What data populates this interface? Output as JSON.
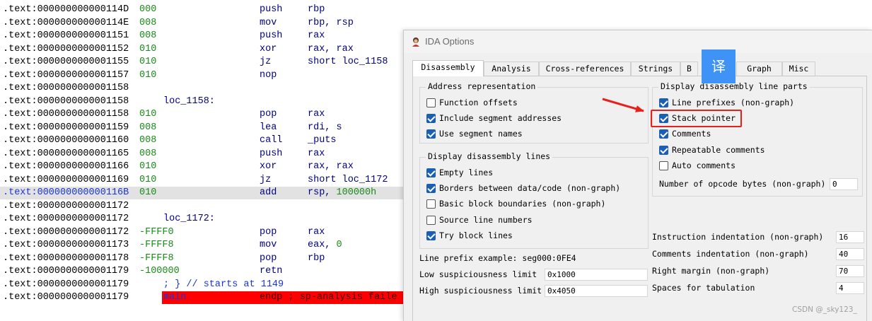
{
  "listing": {
    "lines": [
      {
        "addr": ".text:000000000000114D",
        "sp": "000",
        "mnem": "push",
        "ops": "rbp"
      },
      {
        "addr": ".text:000000000000114E",
        "sp": "008",
        "mnem": "mov",
        "ops": "rbp, rsp"
      },
      {
        "addr": ".text:0000000000001151",
        "sp": "008",
        "mnem": "push",
        "ops": "rax"
      },
      {
        "addr": ".text:0000000000001152",
        "sp": "010",
        "mnem": "xor",
        "ops": "rax, rax"
      },
      {
        "addr": ".text:0000000000001155",
        "sp": "010",
        "mnem": "jz",
        "ops": "short loc_1158"
      },
      {
        "addr": ".text:0000000000001157",
        "sp": "010",
        "mnem": "nop",
        "ops": ""
      },
      {
        "addr": ".text:0000000000001158",
        "sp": "",
        "mnem": "",
        "ops": ""
      },
      {
        "addr": ".text:0000000000001158",
        "sp": "",
        "mnem": "",
        "ops": "",
        "label": "loc_1158:"
      },
      {
        "addr": ".text:0000000000001158",
        "sp": "010",
        "mnem": "pop",
        "ops": "rax"
      },
      {
        "addr": ".text:0000000000001159",
        "sp": "008",
        "mnem": "lea",
        "ops": "rdi, s"
      },
      {
        "addr": ".text:0000000000001160",
        "sp": "008",
        "mnem": "call",
        "ops": "_puts"
      },
      {
        "addr": ".text:0000000000001165",
        "sp": "008",
        "mnem": "push",
        "ops": "rax"
      },
      {
        "addr": ".text:0000000000001166",
        "sp": "010",
        "mnem": "xor",
        "ops": "rax, rax"
      },
      {
        "addr": ".text:0000000000001169",
        "sp": "010",
        "mnem": "jz",
        "ops": "short loc_1172"
      },
      {
        "addr": ".text:000000000000116B",
        "sp": "010",
        "mnem": "add",
        "ops": "rsp, ",
        "num": "100000h",
        "highlight": true
      },
      {
        "addr": ".text:0000000000001172",
        "sp": "",
        "mnem": "",
        "ops": ""
      },
      {
        "addr": ".text:0000000000001172",
        "sp": "",
        "mnem": "",
        "ops": "",
        "label": "loc_1172:"
      },
      {
        "addr": ".text:0000000000001172",
        "sp": "-FFFF0",
        "mnem": "pop",
        "ops": "rax"
      },
      {
        "addr": ".text:0000000000001173",
        "sp": "-FFFF8",
        "mnem": "mov",
        "ops": "eax, ",
        "num": "0"
      },
      {
        "addr": ".text:0000000000001178",
        "sp": "-FFFF8",
        "mnem": "pop",
        "ops": "rbp"
      },
      {
        "addr": ".text:0000000000001179",
        "sp": "-100000",
        "mnem": "retn",
        "ops": ""
      },
      {
        "addr": ".text:0000000000001179",
        "sp": "",
        "mnem": "",
        "ops": "",
        "comment": "; } // starts at 1149"
      },
      {
        "addr": ".text:0000000000001179",
        "sp": "",
        "mnem": "",
        "ops": "",
        "endp": {
          "proc": "main",
          "text": "endp ; sp-analysis faile"
        }
      }
    ]
  },
  "dialog": {
    "title": "IDA Options",
    "tabs": [
      "Disassembly",
      "Analysis",
      "Cross-references",
      "Strings",
      "B",
      "Graph",
      "Misc"
    ],
    "active_tab": "Disassembly",
    "address_representation": {
      "title": "Address representation",
      "items": [
        {
          "label": "Function offsets",
          "checked": false
        },
        {
          "label": "Include segment addresses",
          "checked": true
        },
        {
          "label": "Use segment names",
          "checked": true
        }
      ]
    },
    "display_lines": {
      "title": "Display disassembly lines",
      "items": [
        {
          "label": "Empty lines",
          "checked": true
        },
        {
          "label": "Borders between data/code (non-graph)",
          "checked": true
        },
        {
          "label": "Basic block boundaries (non-graph)",
          "checked": false
        },
        {
          "label": "Source line numbers",
          "checked": false
        },
        {
          "label": "Try block lines",
          "checked": true
        }
      ]
    },
    "line_parts": {
      "title": "Display disassembly line parts",
      "items": [
        {
          "label": "Line prefixes (non-graph)",
          "checked": true
        },
        {
          "label": "Stack pointer",
          "checked": true
        },
        {
          "label": "Comments",
          "checked": true
        },
        {
          "label": "Repeatable comments",
          "checked": true
        },
        {
          "label": "Auto comments",
          "checked": false
        }
      ],
      "opcode_bytes_label": "Number of opcode bytes (non-graph)",
      "opcode_bytes_value": "0"
    },
    "left_fields": {
      "line_prefix_example": "Line prefix example: seg000:0FE4",
      "low_limit_label": "Low suspiciousness limit",
      "low_limit_value": "0x1000",
      "high_limit_label": "High suspiciousness limit",
      "high_limit_value": "0x4050"
    },
    "right_fields": [
      {
        "label": "Instruction indentation (non-graph)",
        "value": "16"
      },
      {
        "label": "Comments indentation (non-graph)",
        "value": "40"
      },
      {
        "label": "Right margin (non-graph)",
        "value": "70"
      },
      {
        "label": "Spaces for tabulation",
        "value": "4"
      }
    ]
  },
  "overlay": {
    "translate_glyph": "译",
    "watermark": "CSDN @_sky123_",
    "accent_color": "#e6201c",
    "badge_color": "#3f92f6"
  }
}
